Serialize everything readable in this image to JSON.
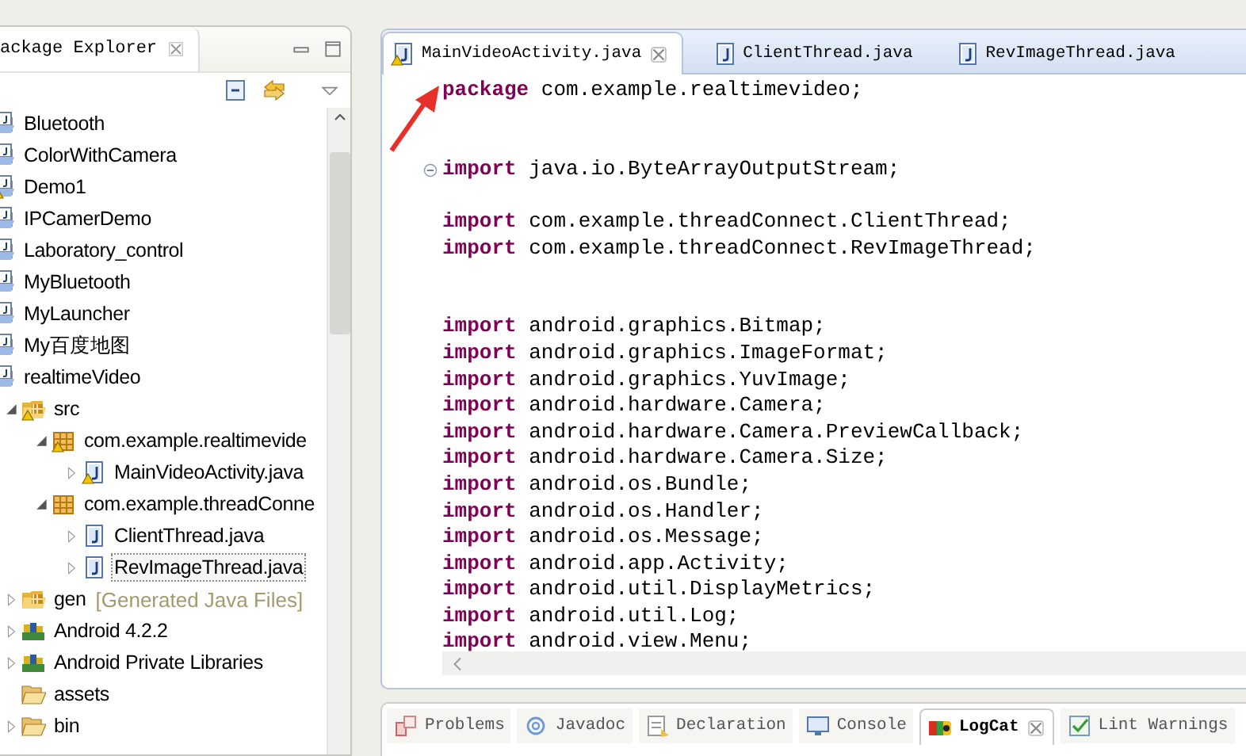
{
  "explorer": {
    "title": "ackage Explorer",
    "tree": [
      {
        "label": "Bluetooth",
        "kind": "project",
        "warning": false,
        "selected": false
      },
      {
        "label": "ColorWithCamera",
        "kind": "project",
        "warning": false,
        "selected": false
      },
      {
        "label": "Demo1",
        "kind": "project",
        "warning": true,
        "selected": false
      },
      {
        "label": "IPCamerDemo",
        "kind": "project",
        "warning": false,
        "selected": false
      },
      {
        "label": "Laboratory_control",
        "kind": "project",
        "warning": false,
        "selected": false
      },
      {
        "label": "MyBluetooth",
        "kind": "project",
        "warning": false,
        "selected": false
      },
      {
        "label": "MyLauncher",
        "kind": "project",
        "warning": false,
        "selected": false
      },
      {
        "label": "My百度地图",
        "kind": "project",
        "warning": false,
        "selected": false
      },
      {
        "label": "realtimeVideo",
        "kind": "project",
        "warning": false,
        "selected": false,
        "children": [
          {
            "label": "src",
            "kind": "source-folder",
            "warning": true,
            "selected": false,
            "expanded": true,
            "children": [
              {
                "label": "com.example.realtimevide",
                "kind": "package",
                "warning": true,
                "selected": false,
                "expanded": true,
                "children": [
                  {
                    "label": "MainVideoActivity.java",
                    "kind": "java-file",
                    "warning": true,
                    "selected": false,
                    "expanded": false
                  }
                ]
              },
              {
                "label": "com.example.threadConne",
                "kind": "package",
                "warning": false,
                "selected": false,
                "expanded": true,
                "children": [
                  {
                    "label": "ClientThread.java",
                    "kind": "java-file",
                    "warning": false,
                    "selected": false,
                    "expanded": false
                  },
                  {
                    "label": "RevImageThread.java",
                    "kind": "java-file",
                    "warning": false,
                    "selected": true,
                    "expanded": false
                  }
                ]
              }
            ]
          },
          {
            "label": "gen",
            "decoration": "[Generated Java Files]",
            "kind": "source-folder",
            "warning": false,
            "selected": false,
            "expanded": false
          },
          {
            "label": "Android 4.2.2",
            "kind": "library",
            "warning": false,
            "selected": false,
            "expanded": false
          },
          {
            "label": "Android Private Libraries",
            "kind": "library",
            "warning": false,
            "selected": false,
            "expanded": false
          },
          {
            "label": "assets",
            "kind": "folder",
            "warning": false,
            "selected": false
          },
          {
            "label": "bin",
            "kind": "folder",
            "warning": false,
            "selected": false,
            "expanded": false
          }
        ]
      }
    ]
  },
  "editor": {
    "tabs": [
      {
        "label": "MainVideoActivity.java",
        "selected": true,
        "warning": true
      },
      {
        "label": "ClientThread.java",
        "selected": false,
        "warning": false
      },
      {
        "label": "RevImageThread.java",
        "selected": false,
        "warning": false
      }
    ],
    "lines": [
      {
        "keyword": "package",
        "text": "com.example.realtimevideo;"
      },
      {
        "kind": "blank"
      },
      {
        "kind": "blank"
      },
      {
        "keyword": "import",
        "text": "java.io.ByteArrayOutputStream;",
        "foldable": true
      },
      {
        "kind": "blank"
      },
      {
        "keyword": "import",
        "text": "com.example.threadConnect.ClientThread;"
      },
      {
        "keyword": "import",
        "text": "com.example.threadConnect.RevImageThread;"
      },
      {
        "kind": "blank"
      },
      {
        "kind": "blank"
      },
      {
        "keyword": "import",
        "text": "android.graphics.Bitmap;"
      },
      {
        "keyword": "import",
        "text": "android.graphics.ImageFormat;"
      },
      {
        "keyword": "import",
        "text": "android.graphics.YuvImage;"
      },
      {
        "keyword": "import",
        "text": "android.hardware.Camera;"
      },
      {
        "keyword": "import",
        "text": "android.hardware.Camera.PreviewCallback;"
      },
      {
        "keyword": "import",
        "text": "android.hardware.Camera.Size;"
      },
      {
        "keyword": "import",
        "text": "android.os.Bundle;"
      },
      {
        "keyword": "import",
        "text": "android.os.Handler;"
      },
      {
        "keyword": "import",
        "text": "android.os.Message;"
      },
      {
        "keyword": "import",
        "text": "android.app.Activity;"
      },
      {
        "keyword": "import",
        "text": "android.util.DisplayMetrics;"
      },
      {
        "keyword": "import",
        "text": "android.util.Log;"
      },
      {
        "keyword": "import",
        "text": "android.view.Menu;"
      }
    ]
  },
  "bottom_panel": {
    "tabs": [
      {
        "label": "Problems",
        "kind": "problems",
        "selected": false
      },
      {
        "label": "Javadoc",
        "kind": "javadoc",
        "selected": false
      },
      {
        "label": "Declaration",
        "kind": "declaration",
        "selected": false
      },
      {
        "label": "Console",
        "kind": "console",
        "selected": false
      },
      {
        "label": "LogCat",
        "kind": "logcat",
        "selected": true
      },
      {
        "label": "Lint Warnings",
        "kind": "lint",
        "selected": false
      }
    ]
  }
}
